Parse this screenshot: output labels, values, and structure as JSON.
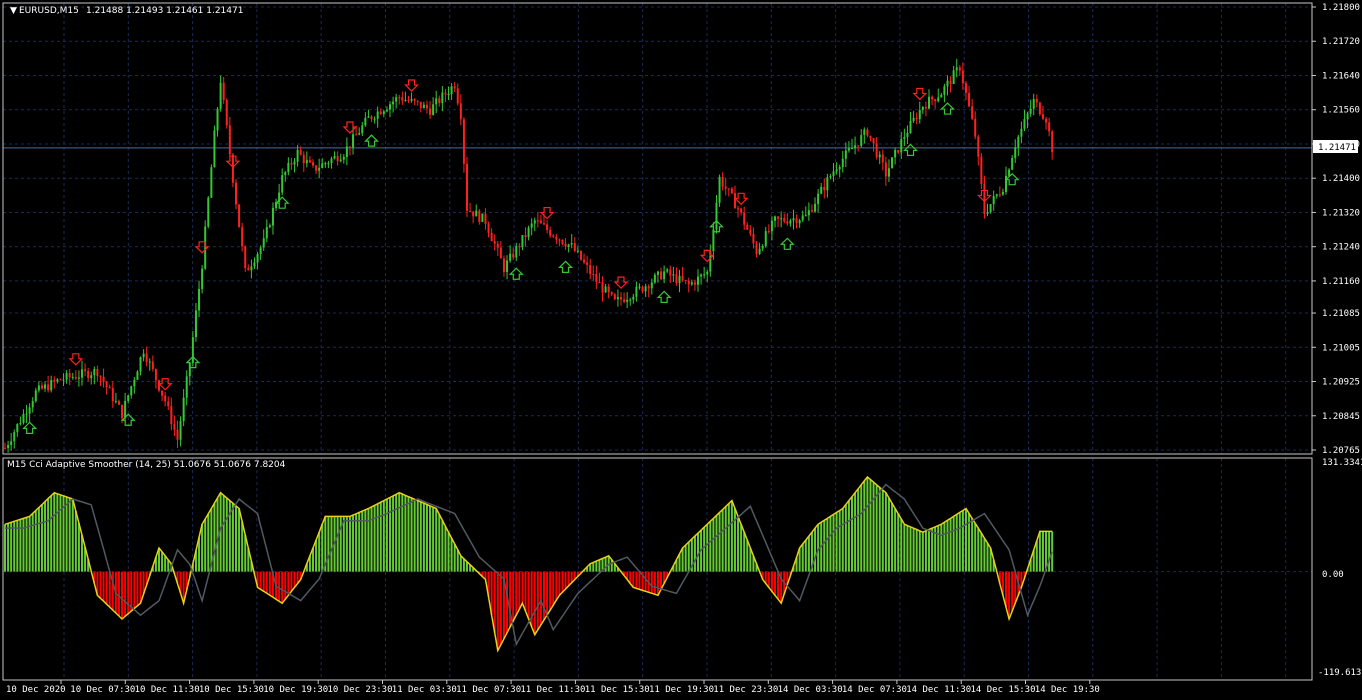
{
  "main_chart": {
    "symbol_timeframe": "EURUSD,M15",
    "ohlc": "1.21488 1.21493 1.21461 1.21471",
    "current_price": "1.21471",
    "price_ticks": [
      "1.21800",
      "1.21720",
      "1.21640",
      "1.21560",
      "1.21480",
      "1.21400",
      "1.21320",
      "1.21240",
      "1.21160",
      "1.21085",
      "1.21005",
      "1.20925",
      "1.20845",
      "1.20765"
    ]
  },
  "indicator": {
    "title": "M15 Cci Adaptive Smoother (14, 25) 51.0676 51.0676 7.8204",
    "scale_max": "131.3341",
    "scale_zero": "0.00",
    "scale_min": "-119.613"
  },
  "time_axis": [
    "10 Dec 2020",
    "10 Dec 07:30",
    "10 Dec 11:30",
    "10 Dec 15:30",
    "10 Dec 19:30",
    "10 Dec 23:30",
    "11 Dec 03:30",
    "11 Dec 07:30",
    "11 Dec 11:30",
    "11 Dec 15:30",
    "11 Dec 19:30",
    "11 Dec 23:30",
    "14 Dec 03:30",
    "14 Dec 07:30",
    "14 Dec 11:30",
    "14 Dec 15:30",
    "14 Dec 19:30"
  ],
  "colors": {
    "background": "#000000",
    "grid": "#1a2a5a",
    "bull": "#34c934",
    "bear": "#ff2020",
    "indicator_up": "#66cc33",
    "indicator_down": "#ff0000",
    "signal_line": "#505a60"
  },
  "chart_data": {
    "type": "candlestick",
    "price_range": [
      1.20765,
      1.218
    ],
    "indicator_range": [
      -119.613,
      131.3341
    ],
    "price_key": [
      [
        0,
        1.2077
      ],
      [
        10,
        1.209
      ],
      [
        18,
        1.2093
      ],
      [
        30,
        1.2095
      ],
      [
        38,
        1.2085
      ],
      [
        45,
        1.21
      ],
      [
        52,
        1.2088
      ],
      [
        56,
        1.2079
      ],
      [
        60,
        1.2097
      ],
      [
        64,
        1.212
      ],
      [
        68,
        1.215
      ],
      [
        70,
        1.2163
      ],
      [
        74,
        1.214
      ],
      [
        78,
        1.2118
      ],
      [
        84,
        1.2125
      ],
      [
        90,
        1.214
      ],
      [
        95,
        1.2146
      ],
      [
        100,
        1.2142
      ],
      [
        110,
        1.2146
      ],
      [
        118,
        1.2154
      ],
      [
        128,
        1.2159
      ],
      [
        138,
        1.2156
      ],
      [
        146,
        1.2162
      ],
      [
        148,
        1.2155
      ],
      [
        150,
        1.2133
      ],
      [
        156,
        1.213
      ],
      [
        162,
        1.2119
      ],
      [
        172,
        1.213
      ],
      [
        184,
        1.2124
      ],
      [
        192,
        1.2116
      ],
      [
        198,
        1.2111
      ],
      [
        206,
        1.2114
      ],
      [
        214,
        1.2118
      ],
      [
        222,
        1.2115
      ],
      [
        228,
        1.2118
      ],
      [
        232,
        1.214
      ],
      [
        238,
        1.2133
      ],
      [
        244,
        1.2123
      ],
      [
        250,
        1.213
      ],
      [
        260,
        1.2131
      ],
      [
        270,
        1.2143
      ],
      [
        280,
        1.2151
      ],
      [
        286,
        1.2141
      ],
      [
        292,
        1.215
      ],
      [
        298,
        1.2157
      ],
      [
        304,
        1.216
      ],
      [
        310,
        1.2166
      ],
      [
        315,
        1.215
      ],
      [
        318,
        1.2132
      ],
      [
        324,
        1.2138
      ],
      [
        328,
        1.2148
      ],
      [
        334,
        1.2158
      ],
      [
        338,
        1.2154
      ],
      [
        340,
        1.2147
      ]
    ],
    "cci_key": [
      [
        0,
        60
      ],
      [
        8,
        70
      ],
      [
        16,
        100
      ],
      [
        22,
        92
      ],
      [
        30,
        -30
      ],
      [
        38,
        -60
      ],
      [
        44,
        -40
      ],
      [
        50,
        30
      ],
      [
        54,
        10
      ],
      [
        58,
        -40
      ],
      [
        64,
        60
      ],
      [
        70,
        100
      ],
      [
        76,
        80
      ],
      [
        82,
        -20
      ],
      [
        90,
        -40
      ],
      [
        96,
        -10
      ],
      [
        104,
        70
      ],
      [
        112,
        70
      ],
      [
        118,
        80
      ],
      [
        128,
        100
      ],
      [
        140,
        80
      ],
      [
        148,
        20
      ],
      [
        156,
        -10
      ],
      [
        160,
        -100
      ],
      [
        168,
        -40
      ],
      [
        172,
        -80
      ],
      [
        180,
        -30
      ],
      [
        190,
        10
      ],
      [
        196,
        20
      ],
      [
        204,
        -20
      ],
      [
        212,
        -30
      ],
      [
        220,
        30
      ],
      [
        228,
        60
      ],
      [
        236,
        90
      ],
      [
        242,
        30
      ],
      [
        246,
        -10
      ],
      [
        252,
        -40
      ],
      [
        258,
        30
      ],
      [
        264,
        60
      ],
      [
        272,
        80
      ],
      [
        280,
        120
      ],
      [
        286,
        100
      ],
      [
        292,
        60
      ],
      [
        298,
        50
      ],
      [
        304,
        60
      ],
      [
        312,
        80
      ],
      [
        320,
        30
      ],
      [
        326,
        -60
      ],
      [
        330,
        -20
      ],
      [
        336,
        51
      ]
    ],
    "sell_arrows": [
      23,
      52,
      64,
      74,
      112,
      132,
      176,
      200,
      228,
      239,
      297,
      318
    ],
    "buy_arrows": [
      8,
      40,
      61,
      90,
      119,
      166,
      182,
      214,
      231,
      254,
      294,
      306,
      327
    ]
  }
}
